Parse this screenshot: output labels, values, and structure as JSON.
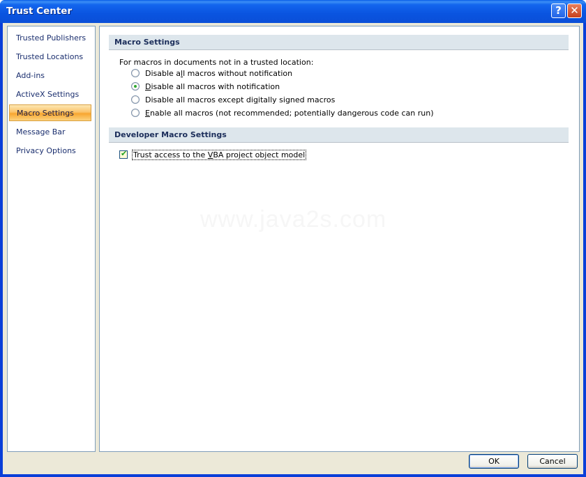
{
  "window": {
    "title": "Trust Center",
    "help_label": "?",
    "close_label": "✕"
  },
  "nav": {
    "items": [
      {
        "label": "Trusted Publishers",
        "selected": false
      },
      {
        "label": "Trusted Locations",
        "selected": false
      },
      {
        "label": "Add-ins",
        "selected": false
      },
      {
        "label": "ActiveX Settings",
        "selected": false
      },
      {
        "label": "Macro Settings",
        "selected": true
      },
      {
        "label": "Message Bar",
        "selected": false
      },
      {
        "label": "Privacy Options",
        "selected": false
      }
    ]
  },
  "macro_settings": {
    "header": "Macro Settings",
    "intro": "For macros in documents not in a trusted location:",
    "options": [
      {
        "pre": "Disable a",
        "key": "l",
        "post": "l macros without notification",
        "checked": false
      },
      {
        "pre": "",
        "key": "D",
        "post": "isable all macros with notification",
        "checked": true
      },
      {
        "pre": "Disable all macros except di",
        "key": "g",
        "post": "itally signed macros",
        "checked": false
      },
      {
        "pre": "",
        "key": "E",
        "post": "nable all macros (not recommended; potentially dangerous code can run)",
        "checked": false
      }
    ]
  },
  "developer_settings": {
    "header": "Developer Macro Settings",
    "trust_vba": {
      "pre": "Trust access to the ",
      "key": "V",
      "post": "BA project object model",
      "checked": true
    }
  },
  "watermark": "www.java2s.com",
  "buttons": {
    "ok": "OK",
    "cancel": "Cancel"
  }
}
